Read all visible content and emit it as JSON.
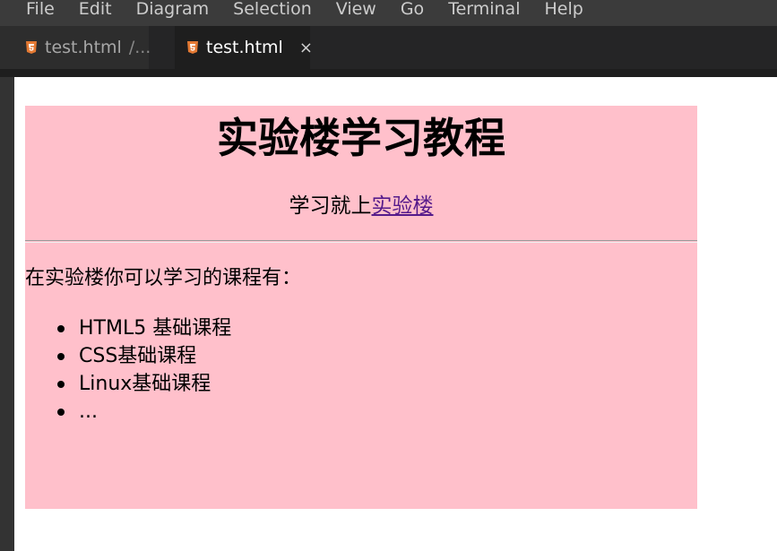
{
  "menubar": {
    "items": [
      "File",
      "Edit",
      "Diagram",
      "Selection",
      "View",
      "Go",
      "Terminal",
      "Help"
    ]
  },
  "tabs": [
    {
      "label": "test.html",
      "path": "/...",
      "active": false
    },
    {
      "label": "test.html",
      "close": "×",
      "active": true
    }
  ],
  "icons": {
    "file_icon": "html5-icon",
    "close": "close-icon"
  },
  "colors": {
    "preview_box": "#ffc0cb",
    "link": "#551a8b",
    "html5_icon": "#e37933"
  },
  "preview": {
    "title": "实验楼学习教程",
    "subtitle_text": "学习就上",
    "subtitle_link": "实验楼",
    "intro": "在实验楼你可以学习的课程有：",
    "courses": [
      "HTML5 基础课程",
      "CSS基础课程",
      "Linux基础课程",
      "..."
    ]
  }
}
